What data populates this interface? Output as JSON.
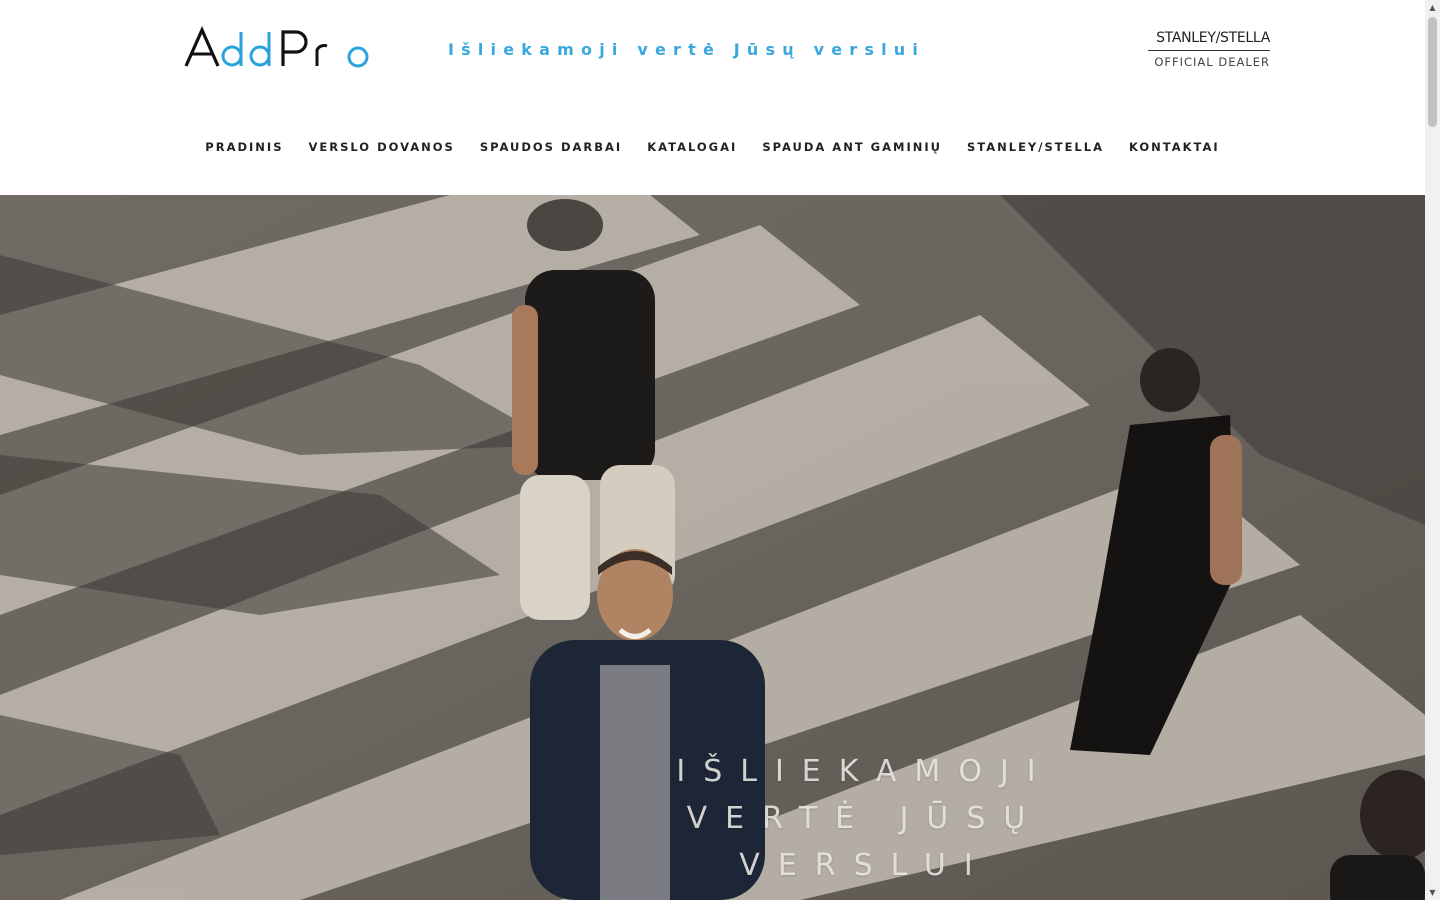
{
  "logo": {
    "text_part1": "A",
    "text_part2": "dd",
    "text_part3": "Pro",
    "text_part4": "o",
    "dark_color": "#111111",
    "accent_color": "#2aa3dd"
  },
  "tagline": "Išliekamoji vertė Jūsų verslui",
  "dealer": {
    "brand": "STANLEY/STELLA",
    "subtitle": "OFFICIAL DEALER"
  },
  "nav": {
    "items": [
      {
        "label": "PRADINIS"
      },
      {
        "label": "VERSLO DOVANOS"
      },
      {
        "label": "SPAUDOS DARBAI"
      },
      {
        "label": "KATALOGAI"
      },
      {
        "label": "SPAUDA ANT GAMINIŲ"
      },
      {
        "label": "STANLEY/STELLA"
      },
      {
        "label": "KONTAKTAI"
      }
    ]
  },
  "hero": {
    "line1": "IŠLIEKAMOJI",
    "line2": "VERTĖ JŪSŲ",
    "line3": "VERSLUI",
    "image_subject": "people-walking-on-crosswalk-photo"
  },
  "scrollbar": {
    "up_icon": "arrow-up-icon",
    "down_icon": "arrow-down-icon"
  },
  "colors": {
    "accent": "#3aa7df",
    "nav_text": "#222222",
    "hero_text": "#ebe8e4"
  }
}
